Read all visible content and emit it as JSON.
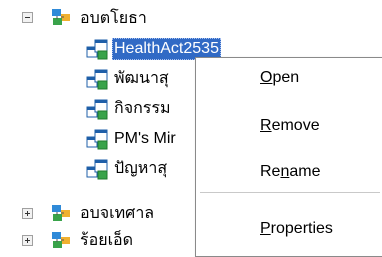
{
  "tree": {
    "root": {
      "label": "อบตโยธา",
      "expanded": true
    },
    "children": [
      {
        "label": "HealthAct2535",
        "selected": true
      },
      {
        "label": "พัฒนาสุ"
      },
      {
        "label": "กิจกรรม"
      },
      {
        "label": "PM's Mir"
      },
      {
        "label": "ปัญหาสุ"
      }
    ],
    "siblings": [
      {
        "label": "อบจเทศาล",
        "expanded": false
      },
      {
        "label": "ร้อยเอ็ด",
        "expanded": false
      }
    ]
  },
  "context_menu": {
    "items": [
      {
        "pre": "",
        "key": "O",
        "post": "pen"
      },
      {
        "pre": "",
        "key": "R",
        "post": "emove"
      },
      {
        "pre": "Re",
        "key": "n",
        "post": "ame"
      },
      {
        "pre": "",
        "key": "P",
        "post": "roperties"
      }
    ]
  },
  "colors": {
    "selection": "#316ac5",
    "folder_icon": "#f0b030",
    "table_icon": "#2f8ad8"
  }
}
